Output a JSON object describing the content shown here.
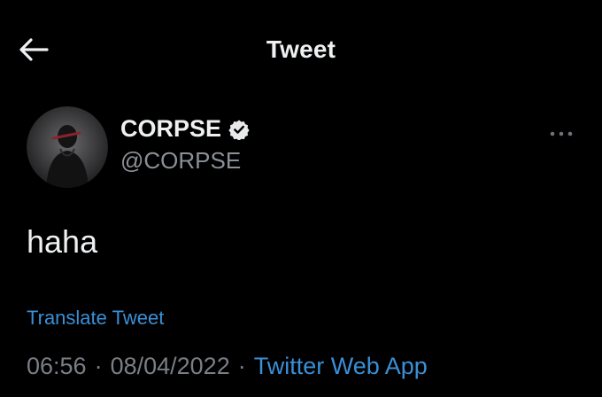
{
  "header": {
    "title": "Tweet",
    "back_icon": "arrow-left-icon"
  },
  "author": {
    "display_name": "CORPSE",
    "handle": "@CORPSE",
    "verified": true,
    "verified_icon": "verified-badge-icon",
    "avatar_icon": "avatar"
  },
  "tweet": {
    "text": "haha",
    "translate_label": "Translate Tweet",
    "time": "06:56",
    "separator": "·",
    "date": "08/04/2022",
    "source": "Twitter Web App",
    "more_icon": "more-options-icon"
  },
  "colors": {
    "background": "#000000",
    "text_primary": "#eef0f1",
    "text_secondary": "#8b9096",
    "link": "#3a8fd6"
  }
}
